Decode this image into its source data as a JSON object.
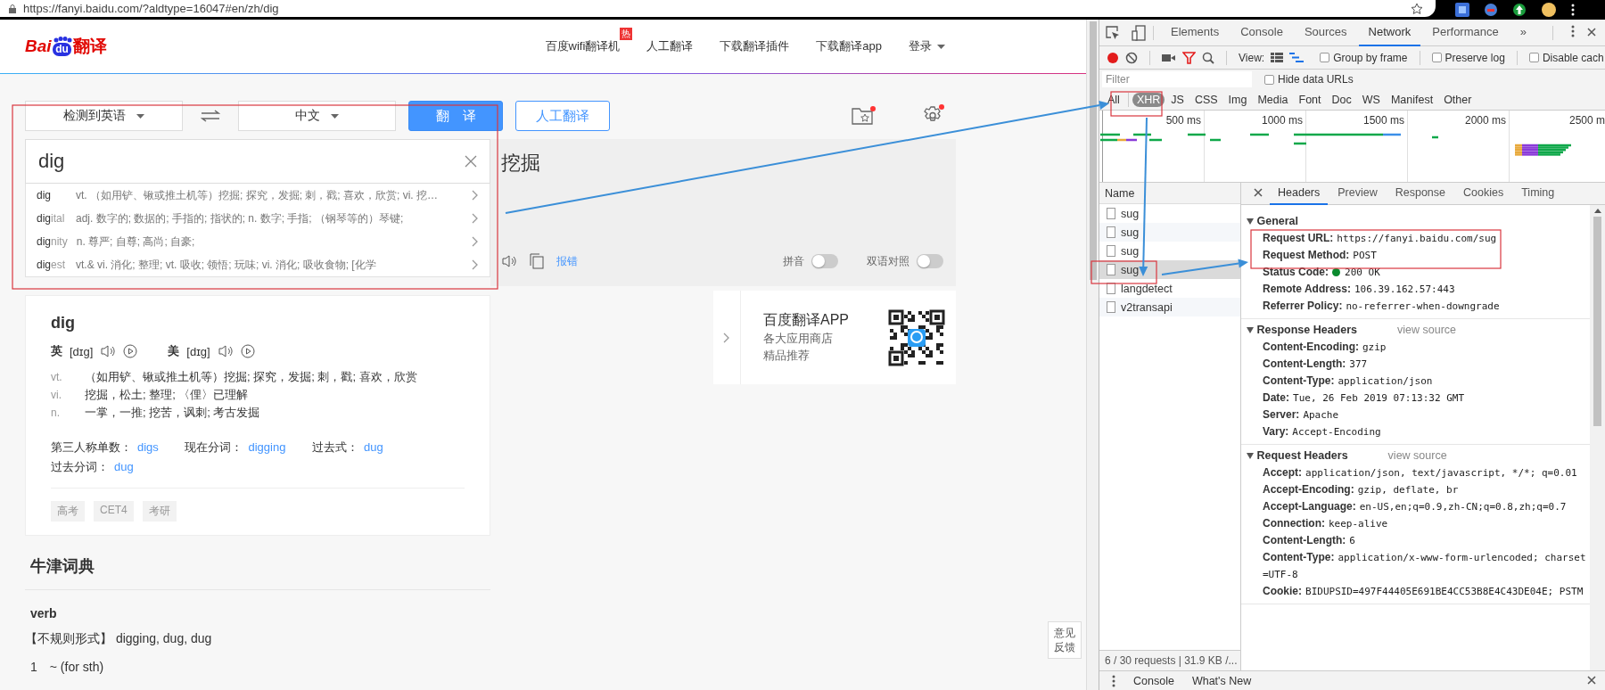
{
  "browser": {
    "url": "https://fanyi.baidu.com/?aldtype=16047#en/zh/dig"
  },
  "page": {
    "logo": {
      "left": "Bai",
      "inner": "du",
      "right": "翻译"
    },
    "nav": [
      {
        "label": "百度wifi翻译机",
        "kind": "link",
        "badge": "热"
      },
      {
        "label": "人工翻译",
        "kind": "link"
      },
      {
        "label": "下载翻译插件",
        "kind": "link"
      },
      {
        "label": "下载翻译app",
        "kind": "link"
      },
      {
        "label": "登录",
        "kind": "menu"
      }
    ],
    "source_language": "检测到英语",
    "target_language": "中文",
    "translate_button": "翻　译",
    "human_button": "人工翻译",
    "input": {
      "value": "dig"
    },
    "suggestions": [
      {
        "word": "**dig**",
        "meaning": "vt. （如用铲、锹或推土机等）挖掘; 探究，发掘; 刺，戳; 喜欢，欣赏; vi. 挖…"
      },
      {
        "word": "**dig**ital",
        "meaning": "adj. 数字的; 数据的; 手指的; 指状的; n. 数字; 手指; （钢琴等的）琴键;"
      },
      {
        "word": "**dig**nity",
        "meaning": "n. 尊严; 自尊; 高尚; 自豪;"
      },
      {
        "word": "**dig**est",
        "meaning": "vt.& vi. 消化; 整理; vt. 吸收; 领悟; 玩味; vi. 消化; 吸收食物; [化学"
      }
    ],
    "output": {
      "text": "挖掘",
      "report": "报错",
      "pinyin": {
        "label": "拼音",
        "on": false
      },
      "bilingual": {
        "label": "双语对照",
        "on": false
      }
    },
    "dictionary": {
      "word": "dig",
      "phonetics": [
        {
          "region": "英",
          "ipa": "[dɪg]"
        },
        {
          "region": "美",
          "ipa": "[dɪg]"
        }
      ],
      "definitions": [
        {
          "pos": "vt.",
          "meaning": "（如用铲、锹或推土机等）挖掘;  探究，发掘;  刺，戳;  喜欢，欣赏"
        },
        {
          "pos": "vi.",
          "meaning": "挖掘，松土;  整理;  〈俚〉已理解"
        },
        {
          "pos": "n.",
          "meaning": "一掌，一推;  挖苦，讽刺;  考古发掘"
        }
      ],
      "forms": [
        {
          "label": "第三人称单数：",
          "value": "digs"
        },
        {
          "label": "现在分词：",
          "value": "digging"
        },
        {
          "label": "过去式：",
          "value": "dug"
        },
        {
          "label": "过去分词：",
          "value": "dug"
        }
      ],
      "tags": [
        "高考",
        "CET4",
        "考研"
      ]
    },
    "app_promo": {
      "title": "百度翻译APP",
      "lines": [
        "各大应用商店",
        "精品推荐"
      ]
    },
    "oxford": {
      "title": "牛津词典",
      "pos": "verb",
      "irregular_label": "【不规则形式】",
      "irregular_forms": "digging, dug, dug",
      "sense_number": "1",
      "sense": "~ (for sth)"
    },
    "feedback": "意见反馈"
  },
  "devtools": {
    "tabs": [
      {
        "label": "Elements",
        "selected": false
      },
      {
        "label": "Console",
        "selected": false
      },
      {
        "label": "Sources",
        "selected": false
      },
      {
        "label": "Network",
        "selected": true
      },
      {
        "label": "Performance",
        "selected": false
      }
    ],
    "more_tabs": "»",
    "toolbar": {
      "view_label": "View:",
      "options": [
        {
          "label": "Group by frame",
          "checked": false
        },
        {
          "label": "Preserve log",
          "checked": false
        },
        {
          "label": "Disable cach",
          "checked": false
        }
      ]
    },
    "filter": {
      "placeholder": "Filter",
      "hide_data_urls": {
        "label": "Hide data URLs",
        "checked": false
      }
    },
    "types": [
      {
        "label": "All",
        "selected": false
      },
      {
        "label": "XHR",
        "selected": true
      },
      {
        "label": "JS",
        "selected": false
      },
      {
        "label": "CSS",
        "selected": false
      },
      {
        "label": "Img",
        "selected": false
      },
      {
        "label": "Media",
        "selected": false
      },
      {
        "label": "Font",
        "selected": false
      },
      {
        "label": "Doc",
        "selected": false
      },
      {
        "label": "WS",
        "selected": false
      },
      {
        "label": "Manifest",
        "selected": false
      },
      {
        "label": "Other",
        "selected": false
      }
    ],
    "timeline": {
      "ticks": [
        "500 ms",
        "1000 ms",
        "1500 ms",
        "2000 ms",
        "2500 m"
      ]
    },
    "requests": {
      "header": "Name",
      "rows": [
        {
          "name": "sug",
          "selected": false
        },
        {
          "name": "sug",
          "selected": false
        },
        {
          "name": "sug",
          "selected": false
        },
        {
          "name": "sug",
          "selected": true
        },
        {
          "name": "langdetect",
          "selected": false
        },
        {
          "name": "v2transapi",
          "selected": false
        }
      ],
      "summary": "6 / 30 requests | 31.9 KB /..."
    },
    "detail_tabs": [
      {
        "label": "Headers",
        "selected": true
      },
      {
        "label": "Preview",
        "selected": false
      },
      {
        "label": "Response",
        "selected": false
      },
      {
        "label": "Cookies",
        "selected": false
      },
      {
        "label": "Timing",
        "selected": false
      }
    ],
    "sections": [
      {
        "title": "General",
        "expanded": true,
        "rows": [
          {
            "kind": "field",
            "name": "Request URL:",
            "value": "https://fanyi.baidu.com/sug"
          },
          {
            "kind": "field",
            "name": "Request Method:",
            "value": "POST"
          },
          {
            "kind": "status",
            "name": "Status Code:",
            "value": "200 OK"
          },
          {
            "kind": "field",
            "name": "Remote Address:",
            "value": "106.39.162.57:443"
          },
          {
            "kind": "field",
            "name": "Referrer Policy:",
            "value": "no-referrer-when-downgrade"
          }
        ]
      },
      {
        "title": "Response Headers",
        "expanded": true,
        "view_source": "view source",
        "rows": [
          {
            "kind": "field",
            "name": "Content-Encoding:",
            "value": "gzip"
          },
          {
            "kind": "field",
            "name": "Content-Length:",
            "value": "377"
          },
          {
            "kind": "field",
            "name": "Content-Type:",
            "value": "application/json"
          },
          {
            "kind": "field",
            "name": "Date:",
            "value": "Tue, 26 Feb 2019 07:13:32 GMT"
          },
          {
            "kind": "field",
            "name": "Server:",
            "value": "Apache"
          },
          {
            "kind": "field",
            "name": "Vary:",
            "value": "Accept-Encoding"
          }
        ]
      },
      {
        "title": "Request Headers",
        "expanded": true,
        "view_source": "view source",
        "rows": [
          {
            "kind": "field",
            "name": "Accept:",
            "value": "application/json, text/javascript, */*; q=0.01"
          },
          {
            "kind": "field",
            "name": "Accept-Encoding:",
            "value": "gzip, deflate, br"
          },
          {
            "kind": "field",
            "name": "Accept-Language:",
            "value": "en-US,en;q=0.9,zh-CN;q=0.8,zh;q=0.7"
          },
          {
            "kind": "field",
            "name": "Connection:",
            "value": "keep-alive"
          },
          {
            "kind": "field",
            "name": "Content-Length:",
            "value": "6"
          },
          {
            "kind": "field",
            "name": "Content-Type:",
            "value": "application/x-www-form-urlencoded; charset=UTF-8"
          },
          {
            "kind": "field",
            "name": "Cookie:",
            "value": "BIDUPSID=497F44405E691BE4CC53B8E4C43DE04E; PSTM"
          }
        ]
      }
    ],
    "drawer": {
      "tabs": [
        "Console",
        "What's New"
      ]
    }
  }
}
